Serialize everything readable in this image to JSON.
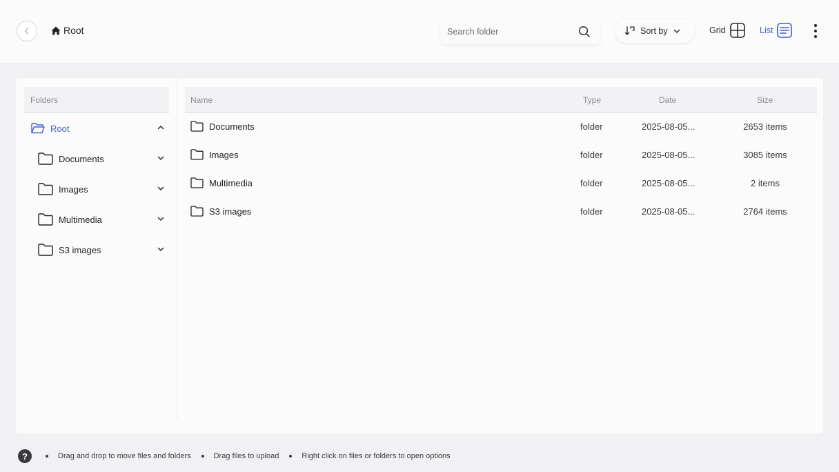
{
  "breadcrumb": {
    "label": "Root"
  },
  "search": {
    "placeholder": "Search folder"
  },
  "toolbar": {
    "sort_label": "Sort by",
    "grid_label": "Grid",
    "list_label": "List"
  },
  "tree": {
    "header": "Folders",
    "root": "Root",
    "items": [
      {
        "label": "Documents"
      },
      {
        "label": "Images"
      },
      {
        "label": "Multimedia"
      },
      {
        "label": "S3 images"
      }
    ]
  },
  "table": {
    "columns": [
      "Name",
      "Type",
      "Date",
      "Size"
    ],
    "rows": [
      {
        "name": "Documents",
        "type": "folder",
        "date": "2025-08-05...",
        "size": "2653 items"
      },
      {
        "name": "Images",
        "type": "folder",
        "date": "2025-08-05...",
        "size": "3085 items"
      },
      {
        "name": "Multimedia",
        "type": "folder",
        "date": "2025-08-05...",
        "size": "2 items"
      },
      {
        "name": "S3 images",
        "type": "folder",
        "date": "2025-08-05...",
        "size": "2764 items"
      }
    ]
  },
  "footer": {
    "help_glyph": "?",
    "tips": [
      "Drag and drop to move files and folders",
      "Drag files to upload",
      "Right click on files or folders to open options"
    ]
  },
  "colors": {
    "accent": "#3d5fd4",
    "text": "#222222",
    "muted": "#8a8a92"
  },
  "icons": [
    "back-icon",
    "home-icon",
    "search-icon",
    "sort-icon",
    "chevron-down-icon",
    "grid-icon",
    "list-icon",
    "more-vertical-icon",
    "folder-open-icon",
    "folder-icon",
    "chevron-up-icon",
    "help-icon"
  ]
}
